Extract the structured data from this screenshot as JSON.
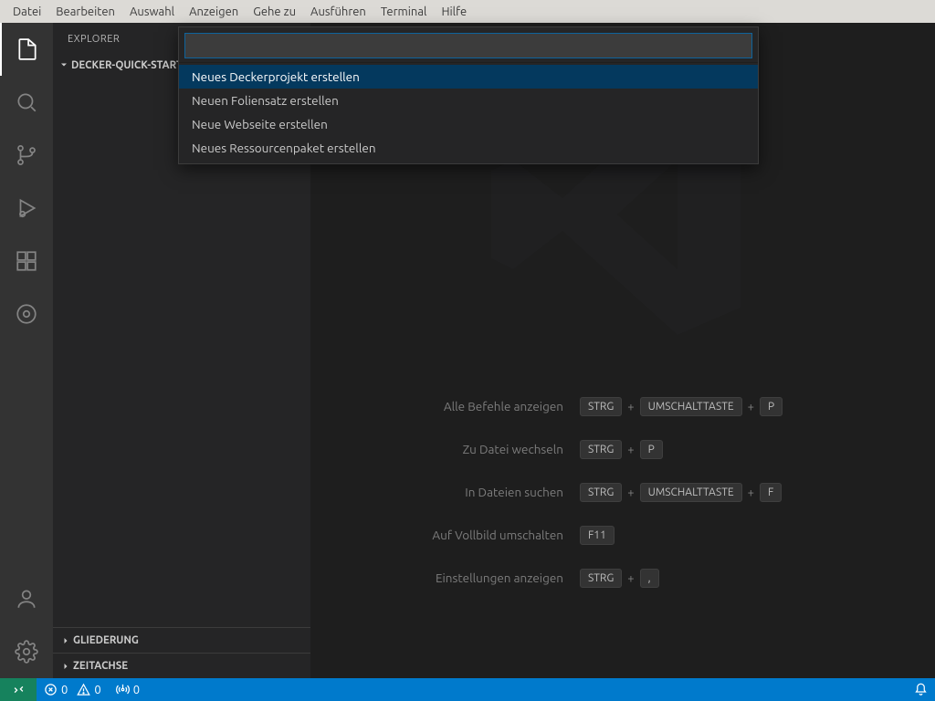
{
  "menubar": {
    "items": [
      "Datei",
      "Bearbeiten",
      "Auswahl",
      "Anzeigen",
      "Gehe zu",
      "Ausführen",
      "Terminal",
      "Hilfe"
    ]
  },
  "sidebar": {
    "title": "EXPLORER",
    "tree_root": "DECKER-QUICK-START",
    "sections": {
      "outline": "GLIEDERUNG",
      "timeline": "ZEITACHSE"
    }
  },
  "palette": {
    "input_value": "",
    "items": [
      "Neues Deckerprojekt erstellen",
      "Neuen Foliensatz erstellen",
      "Neue Webseite erstellen",
      "Neues Ressourcenpaket erstellen"
    ]
  },
  "welcome": {
    "rows": [
      {
        "label": "Alle Befehle anzeigen",
        "keys": [
          "STRG",
          "+",
          "UMSCHALTTASTE",
          "+",
          "P"
        ]
      },
      {
        "label": "Zu Datei wechseln",
        "keys": [
          "STRG",
          "+",
          "P"
        ]
      },
      {
        "label": "In Dateien suchen",
        "keys": [
          "STRG",
          "+",
          "UMSCHALTTASTE",
          "+",
          "F"
        ]
      },
      {
        "label": "Auf Vollbild umschalten",
        "keys": [
          "F11"
        ]
      },
      {
        "label": "Einstellungen anzeigen",
        "keys": [
          "STRG",
          "+",
          ","
        ]
      }
    ]
  },
  "statusbar": {
    "errors": "0",
    "warnings": "0",
    "ports": "0"
  },
  "icons": {
    "files": "files-icon",
    "search": "search-icon",
    "git": "git-branch-icon",
    "debug": "debug-icon",
    "extensions": "extensions-icon",
    "liveshare": "liveshare-icon",
    "account": "account-icon",
    "settings": "gear-icon",
    "remote": "remote-icon",
    "error": "x-circle-icon",
    "warning": "warning-icon",
    "antenna": "radio-tower-icon",
    "bell": "bell-icon"
  }
}
